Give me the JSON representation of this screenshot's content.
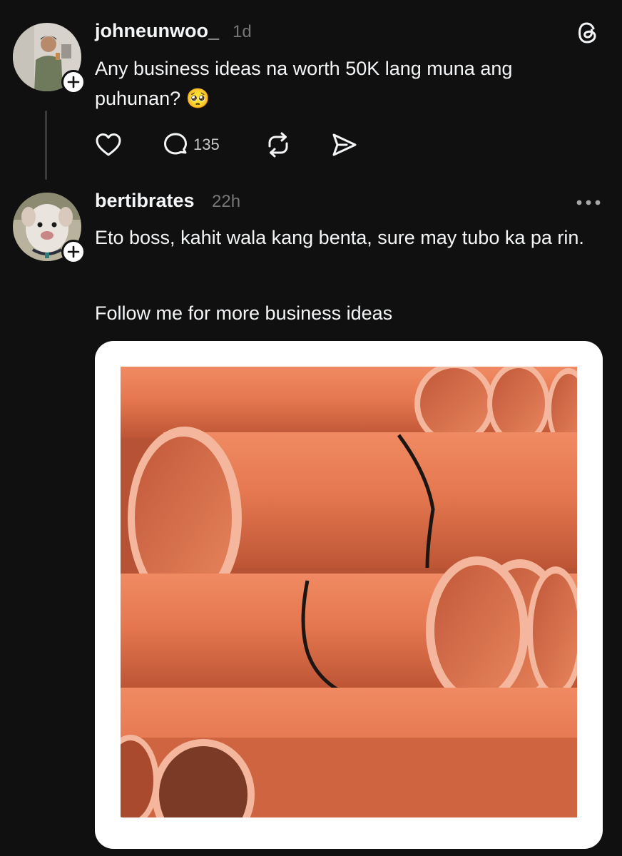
{
  "post1": {
    "username": "johneunwoo_",
    "time": "1d",
    "text": "Any business ideas na worth 50K lang muna ang puhunan? 🥺",
    "reply_count": "135"
  },
  "post2": {
    "username": "bertibrates",
    "time": "22h",
    "text_line1": "Eto boss, kahit wala kang benta, sure may tubo ka pa rin.",
    "text_line2": "Follow me for more business ideas"
  },
  "colors": {
    "background": "#101010",
    "text": "#f3f5f7",
    "muted": "#777777",
    "pipe_orange": "#e2774e"
  },
  "icons": [
    "threads-logo-icon",
    "plus-icon",
    "heart-icon",
    "comment-icon",
    "repost-icon",
    "share-icon",
    "more-icon"
  ]
}
